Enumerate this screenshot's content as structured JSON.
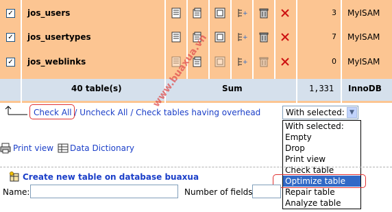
{
  "rows": [
    {
      "name": "jos_users",
      "count": "3",
      "engine": "MyISAM"
    },
    {
      "name": "jos_usertypes",
      "count": "7",
      "engine": "MyISAM"
    },
    {
      "name": "jos_weblinks",
      "count": "0",
      "engine": "MyISAM"
    }
  ],
  "summary": {
    "tables": "40 table(s)",
    "sum": "Sum",
    "total": "1,331",
    "engine": "InnoDB"
  },
  "actions": {
    "check_all": "Check All",
    "sep1": " / ",
    "uncheck_all": "Uncheck All",
    "sep2": " / ",
    "check_overhead": "Check tables having overhead"
  },
  "with_selected": {
    "value": "With selected:",
    "options": [
      "With selected:",
      "Empty",
      "Drop",
      "Print view",
      "Check table",
      "Optimize table",
      "Repair table",
      "Analyze table"
    ],
    "highlighted": "Optimize table"
  },
  "print_view": "Print view",
  "data_dictionary": "Data Dictionary",
  "create": {
    "title": "Create new table on database buaxua",
    "name_label": "Name:",
    "fields_label": "Number of fields:"
  },
  "watermark": "www.buaxua.vn",
  "colors": {
    "row_bg": "#fcc592",
    "summary_bg": "#d5e0ec",
    "link": "#1a3ec8",
    "highlight": "#3169c6",
    "annotation": "#e03030"
  }
}
